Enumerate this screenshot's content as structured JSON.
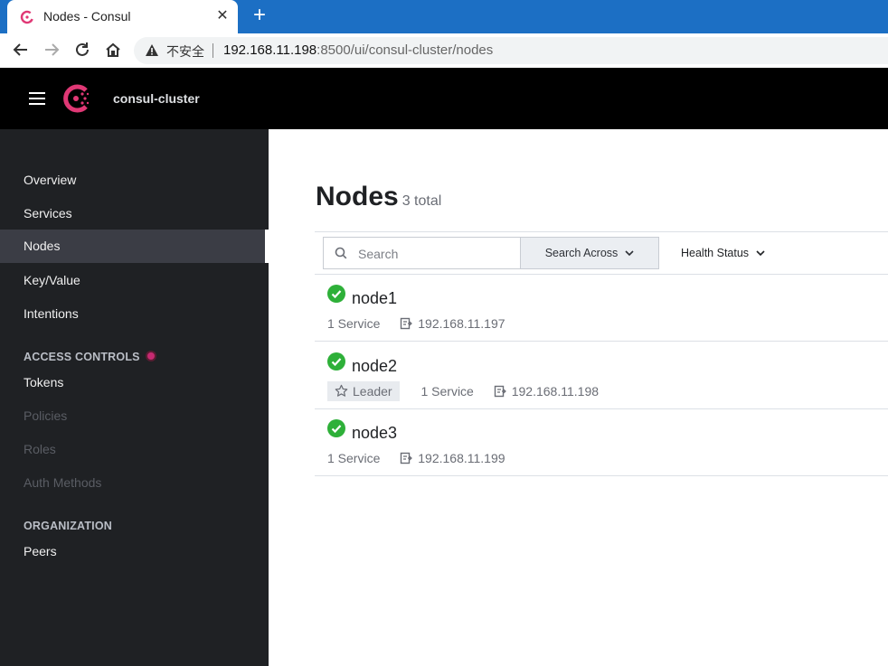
{
  "browser": {
    "tab_title": "Nodes - Consul",
    "tab_close": "✕",
    "new_tab": "+",
    "insecure_label": "不安全",
    "url_host": "192.168.11.198",
    "url_rest": ":8500/ui/consul-cluster/nodes"
  },
  "header": {
    "datacenter": "consul-cluster",
    "brand_color": "#e03875"
  },
  "sidebar": {
    "items": [
      {
        "label": "Overview"
      },
      {
        "label": "Services"
      },
      {
        "label": "Nodes"
      },
      {
        "label": "Key/Value"
      },
      {
        "label": "Intentions"
      }
    ],
    "access_controls": {
      "heading": "ACCESS CONTROLS",
      "items": [
        {
          "label": "Tokens"
        },
        {
          "label": "Policies"
        },
        {
          "label": "Roles"
        },
        {
          "label": "Auth Methods"
        }
      ]
    },
    "organization": {
      "heading": "ORGANIZATION",
      "items": [
        {
          "label": "Peers"
        }
      ]
    }
  },
  "main": {
    "title": "Nodes",
    "count": "3 total",
    "search_placeholder": "Search",
    "search_across_label": "Search Across",
    "health_status_label": "Health Status",
    "nodes": [
      {
        "name": "node1",
        "services": "1 Service",
        "address": "192.168.11.197",
        "leader": ""
      },
      {
        "name": "node2",
        "services": "1 Service",
        "address": "192.168.11.198",
        "leader": "Leader"
      },
      {
        "name": "node3",
        "services": "1 Service",
        "address": "192.168.11.199",
        "leader": ""
      }
    ],
    "healthy_color": "#2eb039"
  }
}
